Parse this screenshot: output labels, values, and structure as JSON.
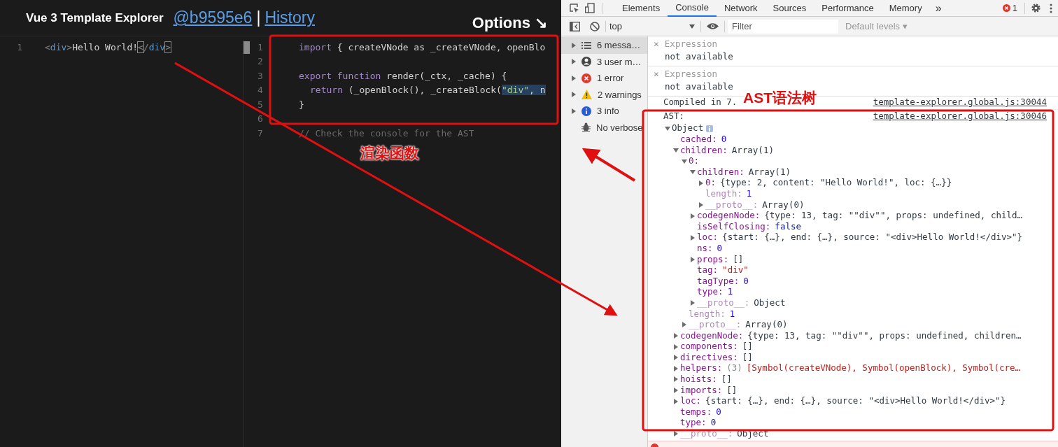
{
  "explorer": {
    "title": "Vue 3 Template Explorer",
    "commit_link": "@b9595e6",
    "separator": "|",
    "history_link": "History",
    "options": "Options ↘",
    "source_lines": [
      {
        "number": "1",
        "tokens": [
          {
            "t": "<",
            "kind": "punct"
          },
          {
            "t": "div",
            "kind": "tag"
          },
          {
            "t": ">",
            "kind": "punct"
          },
          {
            "t": "Hello World!",
            "kind": "plain"
          },
          {
            "t": "<",
            "kind": "match"
          },
          {
            "t": "/",
            "kind": "punct"
          },
          {
            "t": "div",
            "kind": "tag"
          },
          {
            "t": ">",
            "kind": "match"
          }
        ]
      }
    ],
    "output_lines": [
      {
        "number": "1",
        "indented": false,
        "tokens": [
          {
            "t": "import",
            "kind": "keyword",
            "selected": false
          },
          {
            "t": " { createVNode as _createVNode, openBlo",
            "kind": "plain",
            "selected": false
          }
        ]
      },
      {
        "number": "2"
      },
      {
        "number": "3",
        "indented": false,
        "tokens": [
          {
            "t": "export function",
            "kind": "keyword",
            "selected": false
          },
          {
            "t": " render(_ctx, _cache) {",
            "kind": "plain",
            "selected": false
          }
        ]
      },
      {
        "number": "4",
        "indented": true,
        "tokens": [
          {
            "t": "return",
            "kind": "keyword",
            "selected": false
          },
          {
            "t": " (_openBlock(), _createBlock(",
            "kind": "plain",
            "selected": false
          },
          {
            "t": "\"div\"",
            "kind": "string",
            "selected": true
          },
          {
            "t": ", n",
            "kind": "plain",
            "selected": true
          }
        ]
      },
      {
        "number": "5",
        "indented": false,
        "tokens": [
          {
            "t": "}",
            "kind": "plain",
            "selected": false
          }
        ]
      },
      {
        "number": "6"
      },
      {
        "number": "7",
        "indented": false,
        "tokens": [
          {
            "t": "// Check the console for the AST",
            "kind": "comment",
            "selected": false
          }
        ]
      }
    ]
  },
  "devtools": {
    "tabs": [
      {
        "label": "Elements",
        "selected": false
      },
      {
        "label": "Console",
        "selected": true
      },
      {
        "label": "Network",
        "selected": false
      },
      {
        "label": "Sources",
        "selected": false
      },
      {
        "label": "Performance",
        "selected": false
      },
      {
        "label": "Memory",
        "selected": false
      }
    ],
    "more_tabs": "»",
    "error_count": "1",
    "context": "top",
    "filter_placeholder": "Filter",
    "levels": "Default levels ▾",
    "sidebar": [
      {
        "label": "6 messa…",
        "kind": "list",
        "selected": true
      },
      {
        "label": "3 user m…",
        "kind": "user",
        "selected": false
      },
      {
        "label": "1 error",
        "kind": "error",
        "selected": false
      },
      {
        "label": "2 warnings",
        "kind": "warning",
        "selected": false
      },
      {
        "label": "3 info",
        "kind": "info",
        "selected": false
      },
      {
        "label": "No verbose",
        "kind": "verbose",
        "selected": false
      }
    ],
    "expressions": [
      {
        "close": "×",
        "label": "Expression",
        "value": "not available"
      },
      {
        "close": "×",
        "label": "Expression",
        "value": "not available"
      }
    ],
    "logs": [
      {
        "text": "Compiled in 7.",
        "source": "template-explorer.global.js:30044"
      },
      {
        "text": "AST:",
        "source": "template-explorer.global.js:30046"
      }
    ],
    "tree": {
      "label": "Object",
      "expanded": true,
      "children": [
        {
          "key": "cached:",
          "value": "0",
          "kind": "number"
        },
        {
          "key": "children:",
          "value": "Array(1)",
          "kind": "object",
          "expanded": true,
          "children": [
            {
              "key": "0:",
              "expanded": true,
              "children": [
                {
                  "key": "children:",
                  "value": "Array(1)",
                  "kind": "object",
                  "expanded": true,
                  "children": [
                    {
                      "key": "0:",
                      "value": "{type: 2, content: \"Hello World!\", loc: {…}}",
                      "kind": "object",
                      "expanded": false
                    },
                    {
                      "key": "length:",
                      "value": "1",
                      "kind": "number",
                      "internal": true
                    },
                    {
                      "key": "__proto__:",
                      "value": "Array(0)",
                      "kind": "object",
                      "expanded": false,
                      "internal": true
                    }
                  ]
                },
                {
                  "key": "codegenNode:",
                  "value": "{type: 13, tag: \"\"div\"\", props: undefined, child…",
                  "kind": "object",
                  "expanded": false
                },
                {
                  "key": "isSelfClosing:",
                  "value": "false",
                  "kind": "boolean"
                },
                {
                  "key": "loc:",
                  "value": "{start: {…}, end: {…}, source: \"<div>Hello World!</div>\"}",
                  "kind": "object",
                  "expanded": false
                },
                {
                  "key": "ns:",
                  "value": "0",
                  "kind": "number"
                },
                {
                  "key": "props:",
                  "value": "[]",
                  "kind": "object",
                  "expanded": false
                },
                {
                  "key": "tag:",
                  "value": "\"div\"",
                  "kind": "string"
                },
                {
                  "key": "tagType:",
                  "value": "0",
                  "kind": "number"
                },
                {
                  "key": "type:",
                  "value": "1",
                  "kind": "number"
                },
                {
                  "key": "__proto__:",
                  "value": "Object",
                  "kind": "object",
                  "expanded": false,
                  "internal": true
                }
              ]
            },
            {
              "key": "length:",
              "value": "1",
              "kind": "number",
              "internal": true
            },
            {
              "key": "__proto__:",
              "value": "Array(0)",
              "kind": "object",
              "expanded": false,
              "internal": true
            }
          ]
        },
        {
          "key": "codegenNode:",
          "value": "{type: 13, tag: \"\"div\"\", props: undefined, children…",
          "kind": "object",
          "expanded": false
        },
        {
          "key": "components:",
          "value": "[]",
          "kind": "object",
          "expanded": false
        },
        {
          "key": "directives:",
          "value": "[]",
          "kind": "object",
          "expanded": false
        },
        {
          "key": "helpers:",
          "count": "(3)",
          "value": "[Symbol(createVNode), Symbol(openBlock), Symbol(cre…",
          "kind": "string",
          "expanded": false
        },
        {
          "key": "hoists:",
          "value": "[]",
          "kind": "object",
          "expanded": false
        },
        {
          "key": "imports:",
          "value": "[]",
          "kind": "object",
          "expanded": false
        },
        {
          "key": "loc:",
          "value": "{start: {…}, end: {…}, source: \"<div>Hello World!</div>\"}",
          "kind": "object",
          "expanded": false
        },
        {
          "key": "temps:",
          "value": "0",
          "kind": "number"
        },
        {
          "key": "type:",
          "value": "0",
          "kind": "number"
        },
        {
          "key": "__proto__:",
          "value": "Object",
          "kind": "object",
          "expanded": false,
          "internal": true
        }
      ]
    }
  },
  "annotations": [
    {
      "text": "渲染函数"
    },
    {
      "text": "AST语法树"
    }
  ]
}
